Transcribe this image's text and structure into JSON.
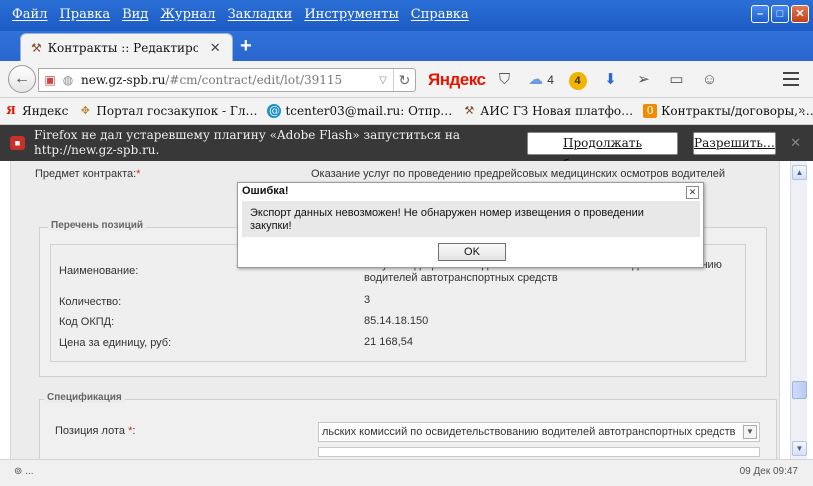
{
  "menu": [
    "Файл",
    "Правка",
    "Вид",
    "Журнал",
    "Закладки",
    "Инструменты",
    "Справка"
  ],
  "tab": {
    "title": "Контракты :: Редактиров…"
  },
  "address": {
    "host": "new.gz-spb.ru",
    "path": "/#cm/contract/edit/lot/39115"
  },
  "yandex_label": "Яндекс",
  "toolbar": {
    "cloud_count": "4",
    "badge_count": "4"
  },
  "bookmarks": [
    {
      "label": "Яндекс"
    },
    {
      "label": "Портал госзакупок - Гл…"
    },
    {
      "label": "tcenter03@mail.ru: Отпр…"
    },
    {
      "label": "АИС ГЗ Новая платфо…"
    },
    {
      "label": "Контракты/договоры, …"
    }
  ],
  "bookmarks_more": "»",
  "plugin_notice": {
    "message": "Firefox не дал устаревшему плагину «Adobe Flash» запуститься на http://new.gz-spb.ru.",
    "block_button": "Продолжать блокировать",
    "allow_button": "Разрешить…"
  },
  "form": {
    "subject_label": "Предмет контракта:",
    "subject_value": "Оказание услуг по проведению предрейсовых медицинских осмотров водителей",
    "positions_title": "Перечень позиций",
    "name_label": "Наименование:",
    "name_value": "Услуги медицинских водительских комиссий по освидетельствованию водителей автотранспортных средств",
    "qty_label": "Количество:",
    "qty_value": "3",
    "okpd_label": "Код ОКПД:",
    "okpd_value": "85.14.18.150",
    "price_label": "Цена за единицу, руб:",
    "price_value": "21 168,54",
    "spec_title": "Спецификация",
    "lot_position_label": "Позиция лота",
    "lot_position_value": "льских комиссий по освидетельствованию водителей автотранспортных средств"
  },
  "status": {
    "left": "...",
    "right": "09 Дек 09:47"
  },
  "dialog": {
    "title": "Ошибка!",
    "message": "Экспорт данных невозможен! Не обнаружен номер извещения о проведении закупки!",
    "ok_label": "OK"
  }
}
